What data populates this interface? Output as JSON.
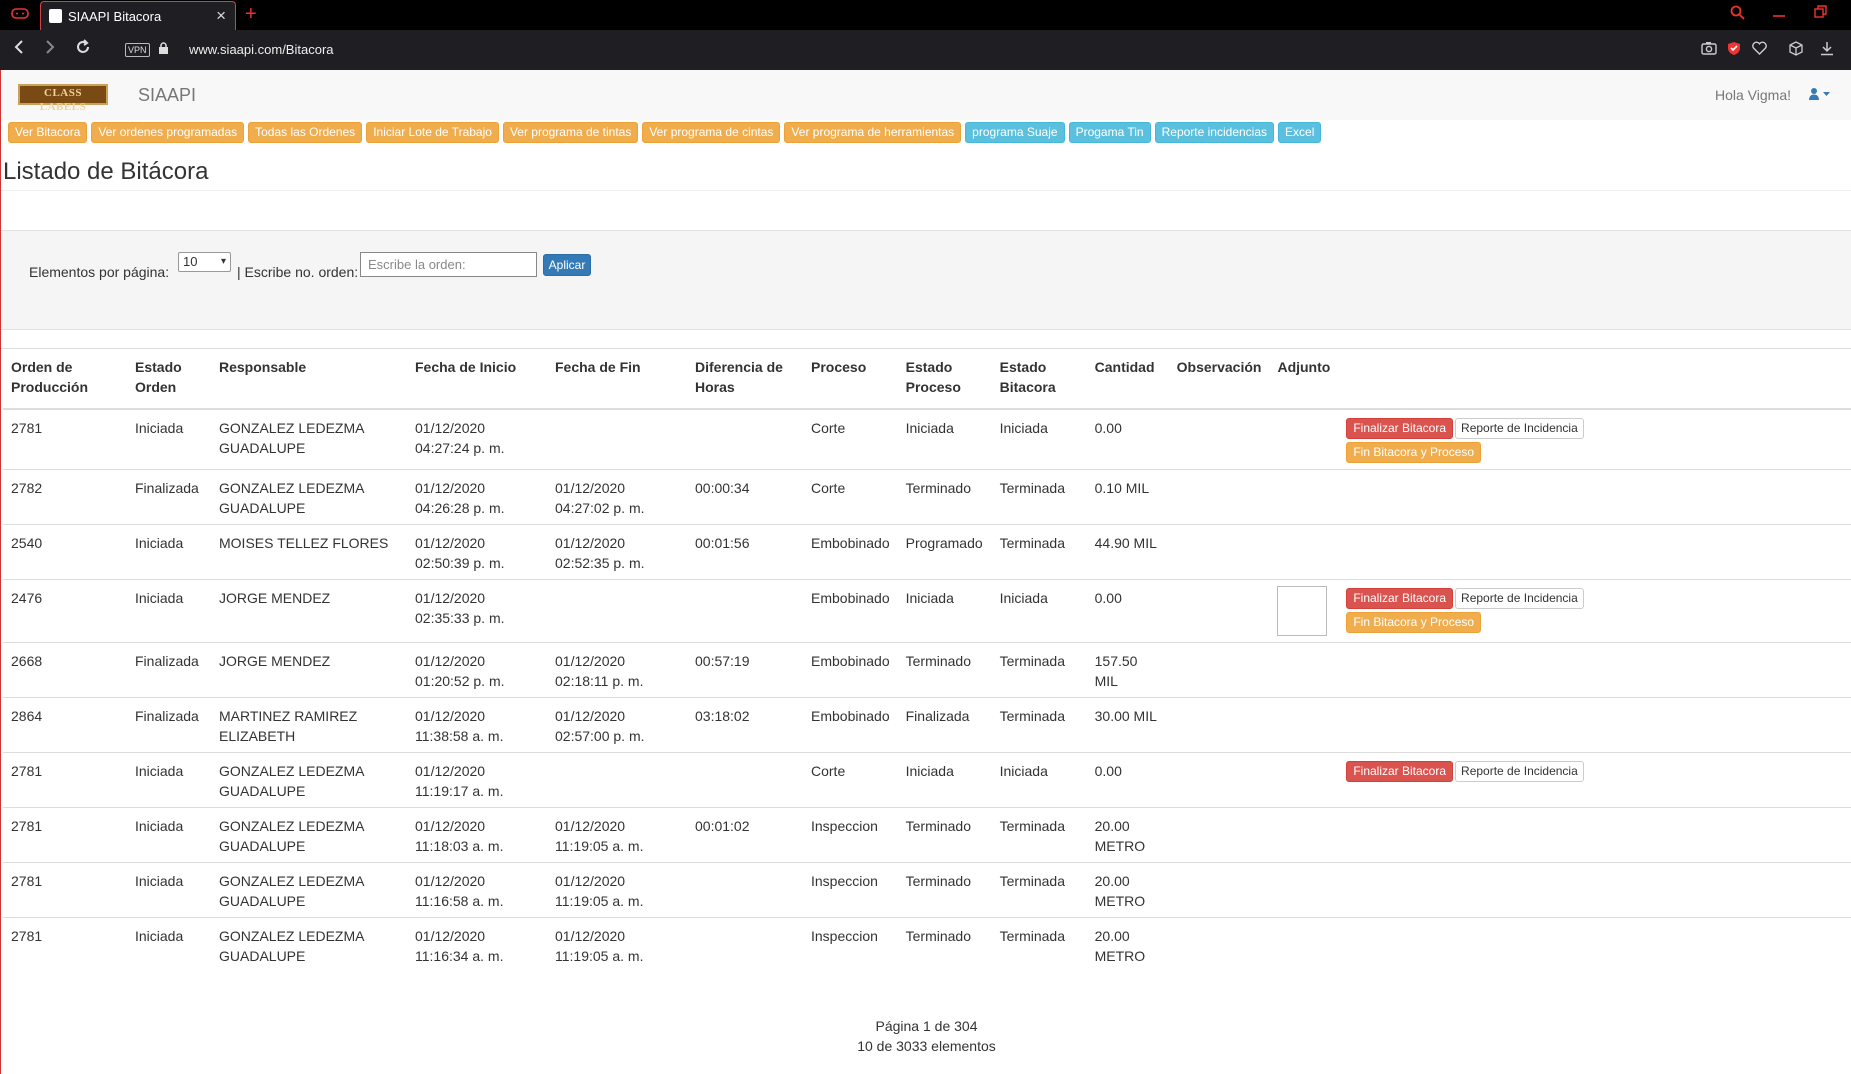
{
  "browser": {
    "tab_title": "SIAAPI Bitacora",
    "vpn_label": "VPN",
    "url": "www.siaapi.com/Bitacora"
  },
  "navbar": {
    "logo_text": "CLASS LABELS",
    "brand": "SIAAPI",
    "greeting": "Hola Vigma!"
  },
  "menu": [
    {
      "label": "Ver Bitacora",
      "style": "warning"
    },
    {
      "label": "Ver ordenes programadas",
      "style": "warning"
    },
    {
      "label": "Todas las Ordenes",
      "style": "warning"
    },
    {
      "label": "Iniciar Lote de Trabajo",
      "style": "warning"
    },
    {
      "label": "Ver programa de tintas",
      "style": "warning"
    },
    {
      "label": "Ver programa de cintas",
      "style": "warning"
    },
    {
      "label": "Ver programa de herramientas",
      "style": "warning"
    },
    {
      "label": "programa Suaje",
      "style": "info"
    },
    {
      "label": "Progama Tin",
      "style": "info"
    },
    {
      "label": "Reporte incidencias",
      "style": "info"
    },
    {
      "label": "Excel",
      "style": "info"
    }
  ],
  "page_title": "Listado de Bitácora",
  "filter": {
    "per_page_label": "Elementos por página:",
    "per_page_value": "10",
    "order_label": "| Escribe no. orden:",
    "order_placeholder": "Escribe la orden:",
    "apply_label": "Aplicar"
  },
  "table": {
    "headers": [
      "Orden de Producción",
      "Estado Orden",
      "Responsable",
      "Fecha de Inicio",
      "Fecha de Fin",
      "Diferencia de Horas",
      "Proceso",
      "Estado Proceso",
      "Estado Bitacora",
      "Cantidad",
      "Observación",
      "Adjunto",
      ""
    ],
    "action_labels": {
      "finalizar": "Finalizar Bitacora",
      "reporte": "Reporte de Incidencia",
      "fin_proceso": "Fin Bitacora y Proceso"
    },
    "rows": [
      {
        "orden": "2781",
        "estado_orden": "Iniciada",
        "responsable": "GONZALEZ LEDEZMA GUADALUPE",
        "inicio": "01/12/2020 04:27:24 p. m.",
        "fin": "",
        "diferencia": "",
        "proceso": "Corte",
        "estado_proceso": "Iniciada",
        "estado_bitacora": "Iniciada",
        "cantidad": "0.00",
        "observacion": "",
        "adjunto": false,
        "actions": [
          "finalizar",
          "reporte",
          "fin_proceso"
        ]
      },
      {
        "orden": "2782",
        "estado_orden": "Finalizada",
        "responsable": "GONZALEZ LEDEZMA GUADALUPE",
        "inicio": "01/12/2020 04:26:28 p. m.",
        "fin": "01/12/2020 04:27:02 p. m.",
        "diferencia": "00:00:34",
        "proceso": "Corte",
        "estado_proceso": "Terminado",
        "estado_bitacora": "Terminada",
        "cantidad": "0.10 MIL",
        "observacion": "",
        "adjunto": false,
        "actions": []
      },
      {
        "orden": "2540",
        "estado_orden": "Iniciada",
        "responsable": "MOISES TELLEZ FLORES",
        "inicio": "01/12/2020 02:50:39 p. m.",
        "fin": "01/12/2020 02:52:35 p. m.",
        "diferencia": "00:01:56",
        "proceso": "Embobinado",
        "estado_proceso": "Programado",
        "estado_bitacora": "Terminada",
        "cantidad": "44.90 MIL",
        "observacion": "",
        "adjunto": false,
        "actions": []
      },
      {
        "orden": "2476",
        "estado_orden": "Iniciada",
        "responsable": "JORGE MENDEZ",
        "inicio": "01/12/2020 02:35:33 p. m.",
        "fin": "",
        "diferencia": "",
        "proceso": "Embobinado",
        "estado_proceso": "Iniciada",
        "estado_bitacora": "Iniciada",
        "cantidad": "0.00",
        "observacion": "",
        "adjunto": true,
        "actions": [
          "finalizar",
          "reporte",
          "fin_proceso"
        ]
      },
      {
        "orden": "2668",
        "estado_orden": "Finalizada",
        "responsable": "JORGE MENDEZ",
        "inicio": "01/12/2020 01:20:52 p. m.",
        "fin": "01/12/2020 02:18:11 p. m.",
        "diferencia": "00:57:19",
        "proceso": "Embobinado",
        "estado_proceso": "Terminado",
        "estado_bitacora": "Terminada",
        "cantidad": "157.50 MIL",
        "observacion": "",
        "adjunto": false,
        "actions": []
      },
      {
        "orden": "2864",
        "estado_orden": "Finalizada",
        "responsable": "MARTINEZ RAMIREZ ELIZABETH",
        "inicio": "01/12/2020 11:38:58 a. m.",
        "fin": "01/12/2020 02:57:00 p. m.",
        "diferencia": "03:18:02",
        "proceso": "Embobinado",
        "estado_proceso": "Finalizada",
        "estado_bitacora": "Terminada",
        "cantidad": "30.00 MIL",
        "observacion": "",
        "adjunto": false,
        "actions": []
      },
      {
        "orden": "2781",
        "estado_orden": "Iniciada",
        "responsable": "GONZALEZ LEDEZMA GUADALUPE",
        "inicio": "01/12/2020 11:19:17 a. m.",
        "fin": "",
        "diferencia": "",
        "proceso": "Corte",
        "estado_proceso": "Iniciada",
        "estado_bitacora": "Iniciada",
        "cantidad": "0.00",
        "observacion": "",
        "adjunto": false,
        "actions": [
          "finalizar",
          "reporte"
        ]
      },
      {
        "orden": "2781",
        "estado_orden": "Iniciada",
        "responsable": "GONZALEZ LEDEZMA GUADALUPE",
        "inicio": "01/12/2020 11:18:03 a. m.",
        "fin": "01/12/2020 11:19:05 a. m.",
        "diferencia": "00:01:02",
        "proceso": "Inspeccion",
        "estado_proceso": "Terminado",
        "estado_bitacora": "Terminada",
        "cantidad": "20.00 METRO",
        "observacion": "",
        "adjunto": false,
        "actions": []
      },
      {
        "orden": "2781",
        "estado_orden": "Iniciada",
        "responsable": "GONZALEZ LEDEZMA GUADALUPE",
        "inicio": "01/12/2020 11:16:58 a. m.",
        "fin": "01/12/2020 11:19:05 a. m.",
        "diferencia": "",
        "proceso": "Inspeccion",
        "estado_proceso": "Terminado",
        "estado_bitacora": "Terminada",
        "cantidad": "20.00 METRO",
        "observacion": "",
        "adjunto": false,
        "actions": []
      },
      {
        "orden": "2781",
        "estado_orden": "Iniciada",
        "responsable": "GONZALEZ LEDEZMA GUADALUPE",
        "inicio": "01/12/2020 11:16:34 a. m.",
        "fin": "01/12/2020 11:19:05 a. m.",
        "diferencia": "",
        "proceso": "Inspeccion",
        "estado_proceso": "Terminado",
        "estado_bitacora": "Terminada",
        "cantidad": "20.00 METRO",
        "observacion": "",
        "adjunto": false,
        "actions": []
      }
    ]
  },
  "pager": {
    "page_text": "Página 1 de 304",
    "count_text": "10 de 3033 elementos"
  }
}
